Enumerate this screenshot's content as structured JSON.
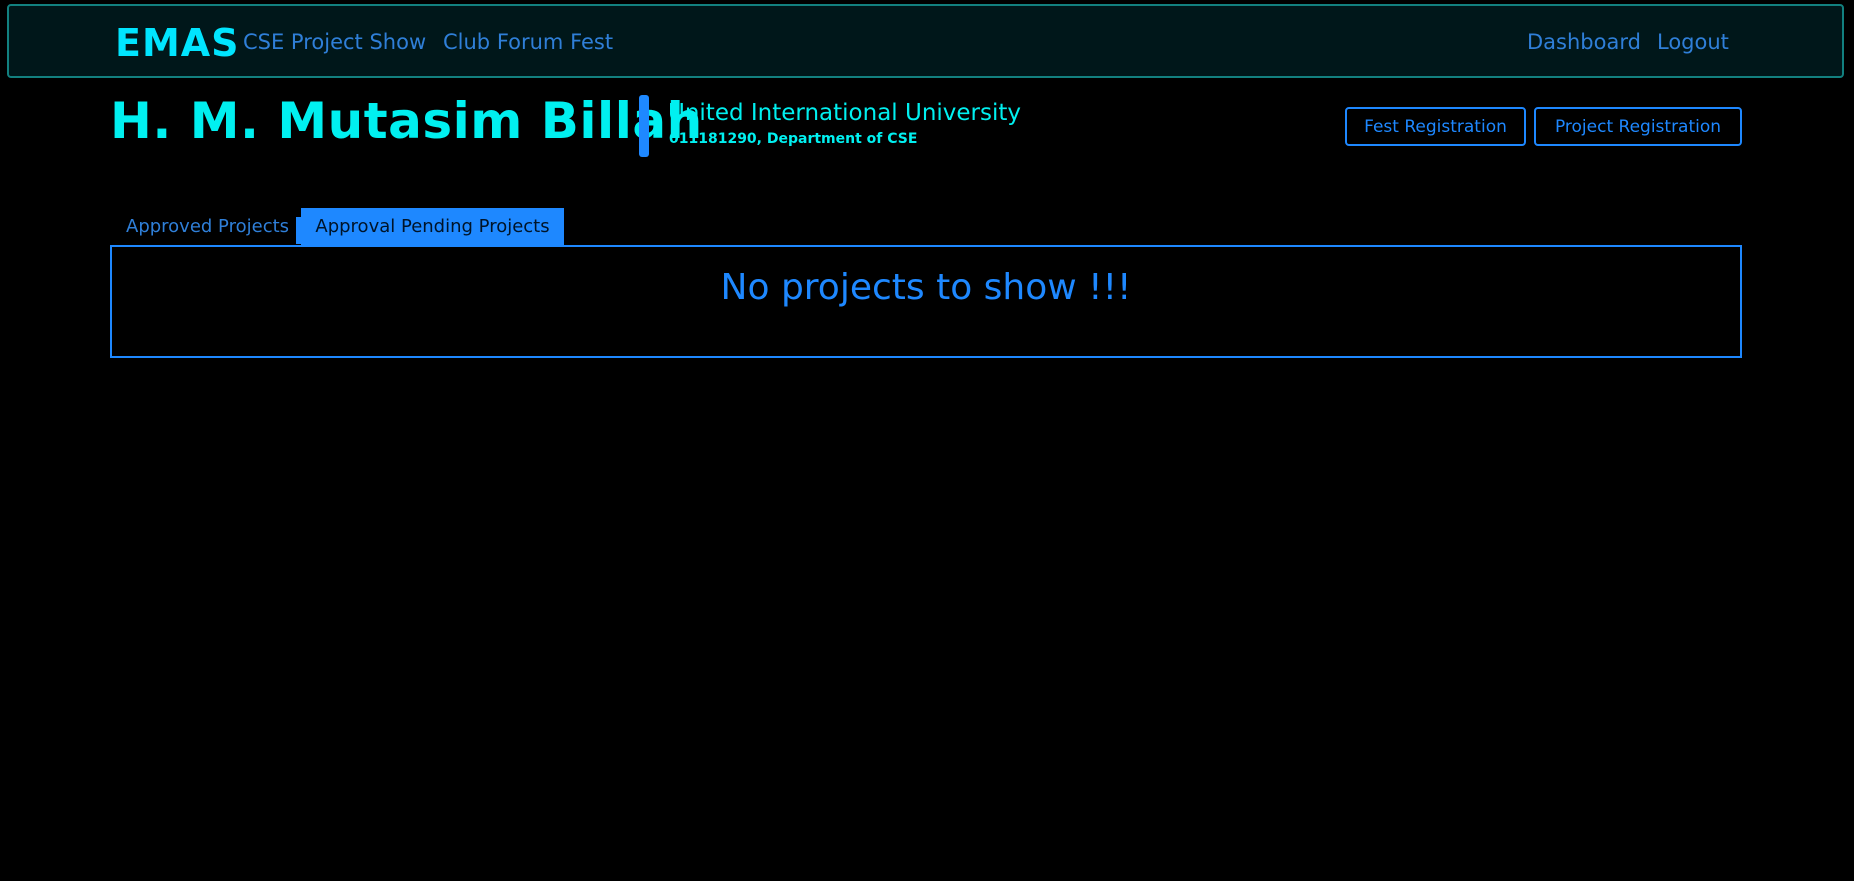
{
  "navbar": {
    "brand": "EMAS",
    "left_links": [
      "CSE Project Show",
      "Club Forum Fest"
    ],
    "right_links": [
      "Dashboard",
      "Logout"
    ]
  },
  "profile": {
    "name": "H. M. Mutasim Billah",
    "university": "United International University",
    "details": "011181290, Department of CSE"
  },
  "actions": {
    "fest_registration": "Fest Registration",
    "project_registration": "Project Registration"
  },
  "tabs": [
    {
      "label": "Approved Projects",
      "active": false
    },
    {
      "label": "Approval Pending Projects",
      "active": true
    }
  ],
  "content": {
    "empty_message": "No projects to show !!!"
  },
  "colors": {
    "background": "#000000",
    "navbar_bg": "#00171a",
    "navbar_border": "#12807f",
    "accent_cyan": "#00f0f0",
    "accent_blue": "#1e88ff",
    "link_blue": "#2f7fd8"
  }
}
